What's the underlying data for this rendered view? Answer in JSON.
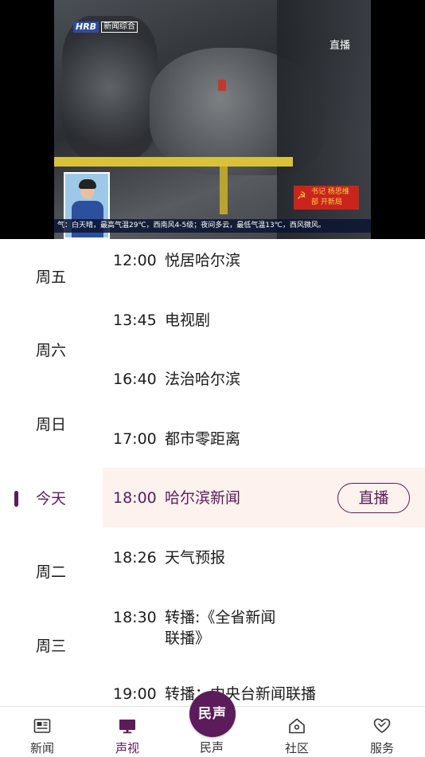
{
  "player": {
    "channel_logo": "HRB",
    "channel_name": "新闻综合",
    "live_badge": "直播",
    "party_banner_line1": "书记 杨思维",
    "party_banner_line2": "部 开新局",
    "ticker": "气：白天晴，最高气温29℃，西南风4-5级；夜间多云，最低气温13℃，西风微风。"
  },
  "days": [
    {
      "label": "周五"
    },
    {
      "label": "周六"
    },
    {
      "label": "周日"
    },
    {
      "label": "今天",
      "active": true
    },
    {
      "label": "周二"
    },
    {
      "label": "周三"
    }
  ],
  "programs": [
    {
      "time": "12:00",
      "title": "悦居哈尔滨"
    },
    {
      "time": "13:45",
      "title": "电视剧"
    },
    {
      "time": "16:40",
      "title": "法治哈尔滨"
    },
    {
      "time": "17:00",
      "title": "都市零距离"
    },
    {
      "time": "18:00",
      "title": "哈尔滨新闻",
      "current": true,
      "live_button": "直播"
    },
    {
      "time": "18:26",
      "title": "天气预报"
    },
    {
      "time": "18:30",
      "title": "转播:《全省新闻联播》"
    },
    {
      "time": "19:00",
      "title": "转播：中央台新闻联播"
    }
  ],
  "tabbar": {
    "news": "新闻",
    "video": "声视",
    "center": "民声",
    "community": "社区",
    "service": "服务",
    "active": "video",
    "accent_color": "#5c1b5a"
  }
}
